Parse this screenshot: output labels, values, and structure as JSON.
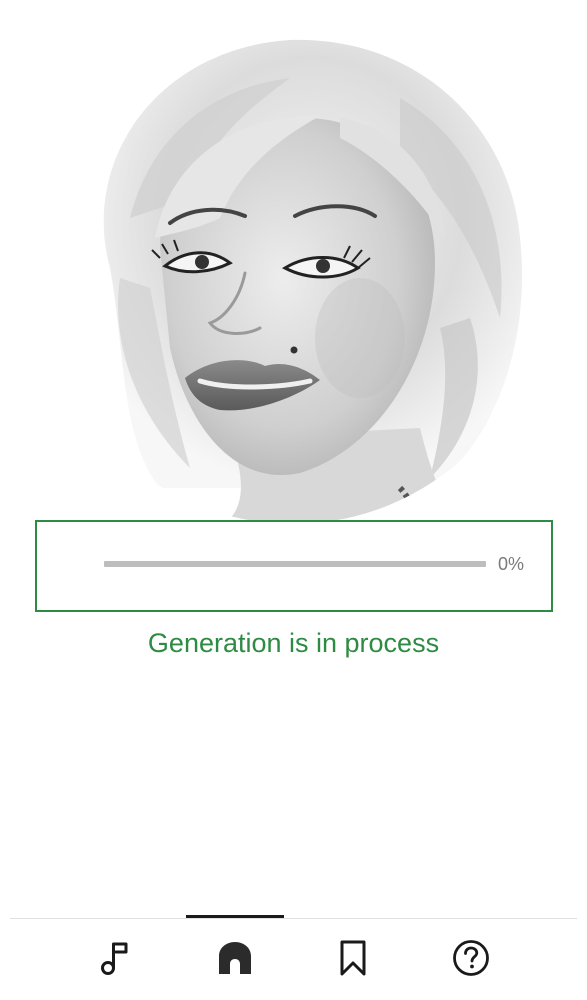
{
  "portrait": {
    "icon": "portrait-photo"
  },
  "progress": {
    "value": 0,
    "label": "0%",
    "accent_color": "#2e8b43",
    "track_color": "#bdbdbd"
  },
  "status": {
    "text": "Generation is in process"
  },
  "nav": {
    "active_index": 1,
    "items": [
      {
        "name": "music",
        "icon": "music-note-icon"
      },
      {
        "name": "home",
        "icon": "home-icon"
      },
      {
        "name": "saved",
        "icon": "bookmark-icon"
      },
      {
        "name": "help",
        "icon": "help-circle-icon"
      }
    ]
  }
}
